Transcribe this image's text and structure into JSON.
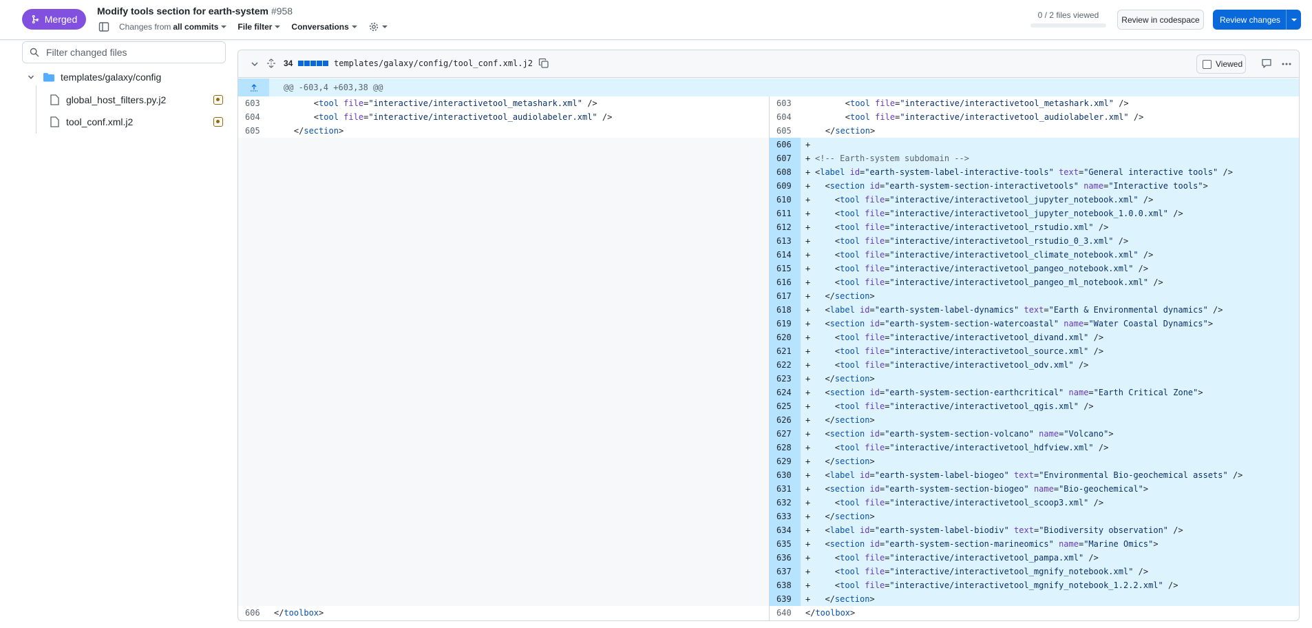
{
  "header": {
    "status_label": "Merged",
    "pr_title": "Modify tools section for earth-system",
    "pr_number": "#958",
    "changes_from_prefix": "Changes from",
    "changes_from_value": "all commits",
    "file_filter_label": "File filter",
    "conversations_label": "Conversations",
    "files_viewed": "0 / 2 files viewed",
    "files_viewed_progress": 0,
    "review_codespace_label": "Review in codespace",
    "review_changes_label": "Review changes"
  },
  "sidebar": {
    "filter_placeholder": "Filter changed files",
    "folder": "templates/galaxy/config",
    "files": [
      "global_host_filters.py.j2",
      "tool_conf.xml.j2"
    ]
  },
  "diff": {
    "changed_count": "34",
    "file_path": "templates/galaxy/config/tool_conf.xml.j2",
    "viewed_label": "Viewed",
    "hunk_header": "@@ -603,4 +603,38 @@",
    "left_lines": [
      {
        "n": "603",
        "t": "        <tool file=\"interactive/interactivetool_metashark.xml\" />"
      },
      {
        "n": "604",
        "t": "        <tool file=\"interactive/interactivetool_audiolabeler.xml\" />"
      },
      {
        "n": "605",
        "t": "    </section>"
      }
    ],
    "left_tail": {
      "n": "606",
      "t": "</toolbox>"
    },
    "right_context": [
      {
        "n": "603",
        "t": "        <tool file=\"interactive/interactivetool_metashark.xml\" />"
      },
      {
        "n": "604",
        "t": "        <tool file=\"interactive/interactivetool_audiolabeler.xml\" />"
      },
      {
        "n": "605",
        "t": "    </section>"
      }
    ],
    "right_added": [
      {
        "n": "606",
        "t": ""
      },
      {
        "n": "607",
        "t": "<!-- Earth-system subdomain -->"
      },
      {
        "n": "608",
        "t": "<label id=\"earth-system-label-interactive-tools\" text=\"General interactive tools\" />"
      },
      {
        "n": "609",
        "t": "  <section id=\"earth-system-section-interactivetools\" name=\"Interactive tools\">"
      },
      {
        "n": "610",
        "t": "    <tool file=\"interactive/interactivetool_jupyter_notebook.xml\" />"
      },
      {
        "n": "611",
        "t": "    <tool file=\"interactive/interactivetool_jupyter_notebook_1.0.0.xml\" />"
      },
      {
        "n": "612",
        "t": "    <tool file=\"interactive/interactivetool_rstudio.xml\" />"
      },
      {
        "n": "613",
        "t": "    <tool file=\"interactive/interactivetool_rstudio_0_3.xml\" />"
      },
      {
        "n": "614",
        "t": "    <tool file=\"interactive/interactivetool_climate_notebook.xml\" />"
      },
      {
        "n": "615",
        "t": "    <tool file=\"interactive/interactivetool_pangeo_notebook.xml\" />"
      },
      {
        "n": "616",
        "t": "    <tool file=\"interactive/interactivetool_pangeo_ml_notebook.xml\" />"
      },
      {
        "n": "617",
        "t": "  </section>"
      },
      {
        "n": "618",
        "t": "  <label id=\"earth-system-label-dynamics\" text=\"Earth & Environmental dynamics\" />"
      },
      {
        "n": "619",
        "t": "  <section id=\"earth-system-section-watercoastal\" name=\"Water Coastal Dynamics\">"
      },
      {
        "n": "620",
        "t": "    <tool file=\"interactive/interactivetool_divand.xml\" />"
      },
      {
        "n": "621",
        "t": "    <tool file=\"interactive/interactivetool_source.xml\" />"
      },
      {
        "n": "622",
        "t": "    <tool file=\"interactive/interactivetool_odv.xml\" />"
      },
      {
        "n": "623",
        "t": "  </section>"
      },
      {
        "n": "624",
        "t": "  <section id=\"earth-system-section-earthcritical\" name=\"Earth Critical Zone\">"
      },
      {
        "n": "625",
        "t": "    <tool file=\"interactive/interactivetool_qgis.xml\" />"
      },
      {
        "n": "626",
        "t": "  </section>"
      },
      {
        "n": "627",
        "t": "  <section id=\"earth-system-section-volcano\" name=\"Volcano\">"
      },
      {
        "n": "628",
        "t": "    <tool file=\"interactive/interactivetool_hdfview.xml\" />"
      },
      {
        "n": "629",
        "t": "  </section>"
      },
      {
        "n": "630",
        "t": "  <label id=\"earth-system-label-biogeo\" text=\"Environmental Bio-geochemical assets\" />"
      },
      {
        "n": "631",
        "t": "  <section id=\"earth-system-section-biogeo\" name=\"Bio-geochemical\">"
      },
      {
        "n": "632",
        "t": "    <tool file=\"interactive/interactivetool_scoop3.xml\" />"
      },
      {
        "n": "633",
        "t": "  </section>"
      },
      {
        "n": "634",
        "t": "  <label id=\"earth-system-label-biodiv\" text=\"Biodiversity observation\" />"
      },
      {
        "n": "635",
        "t": "  <section id=\"earth-system-section-marineomics\" name=\"Marine Omics\">"
      },
      {
        "n": "636",
        "t": "    <tool file=\"interactive/interactivetool_pampa.xml\" />"
      },
      {
        "n": "637",
        "t": "    <tool file=\"interactive/interactivetool_mgnify_notebook.xml\" />"
      },
      {
        "n": "638",
        "t": "    <tool file=\"interactive/interactivetool_mgnify_notebook_1.2.2.xml\" />"
      },
      {
        "n": "639",
        "t": "  </section>"
      }
    ],
    "right_tail": {
      "n": "640",
      "t": "</toolbox>"
    }
  },
  "colors": {
    "merged": "#8250df",
    "primary": "#0969da",
    "added_bg": "#ddf4ff",
    "added_num_bg": "#b6e3ff"
  }
}
